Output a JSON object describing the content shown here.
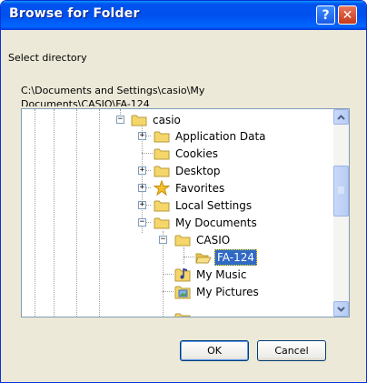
{
  "dialog": {
    "title": "Browse for Folder",
    "help_symbol": "?",
    "close_symbol": "✕"
  },
  "labels": {
    "select_directory": "Select directory",
    "path_line1": "C:\\Documents and Settings\\casio\\My",
    "path_line2": "Documents\\CASIO\\FA-124"
  },
  "tree": {
    "items": [
      {
        "label": "casio",
        "expander": "−",
        "icon": "folder-icon"
      },
      {
        "label": "Application Data",
        "expander": "+",
        "icon": "folder-icon"
      },
      {
        "label": "Cookies",
        "expander": "",
        "icon": "folder-icon"
      },
      {
        "label": "Desktop",
        "expander": "+",
        "icon": "folder-icon"
      },
      {
        "label": "Favorites",
        "expander": "+",
        "icon": "star-icon"
      },
      {
        "label": "Local Settings",
        "expander": "+",
        "icon": "folder-icon"
      },
      {
        "label": "My Documents",
        "expander": "−",
        "icon": "folder-icon"
      },
      {
        "label": "CASIO",
        "expander": "−",
        "icon": "folder-icon"
      },
      {
        "label": "FA-124",
        "expander": "",
        "icon": "open-folder-icon",
        "selected": true
      },
      {
        "label": "My Music",
        "expander": "",
        "icon": "music-folder-icon"
      },
      {
        "label": "My Pictures",
        "expander": "",
        "icon": "pictures-folder-icon"
      }
    ]
  },
  "buttons": {
    "ok": "OK",
    "cancel": "Cancel"
  },
  "colors": {
    "titlebar": "#0054E3",
    "dialog_bg": "#ECE9D8",
    "selection": "#316AC5",
    "folder_yellow": "#F5D66B"
  }
}
